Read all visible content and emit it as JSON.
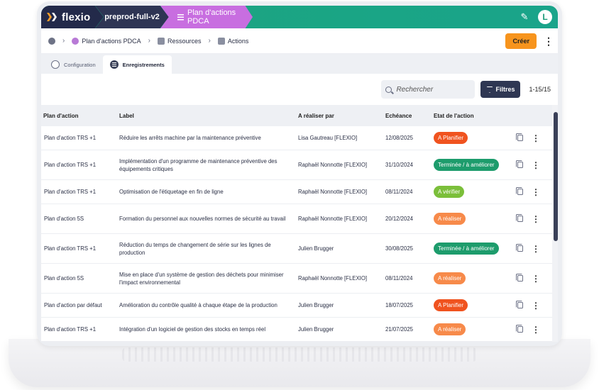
{
  "topbar": {
    "logo": "flexio",
    "environment": "preprod-full-v2",
    "app_name": "Plan d'actions PDCA",
    "avatar_letter": "L"
  },
  "breadcrumb": {
    "items": [
      "Plan d'actions PDCA",
      "Ressources",
      "Actions"
    ]
  },
  "toolbar": {
    "create_label": "Créer"
  },
  "tabs": [
    "Configuration",
    "Enregistrements"
  ],
  "search": {
    "placeholder": "Rechercher"
  },
  "filters": {
    "label": "Filtres",
    "pager": "1-15/15"
  },
  "table": {
    "headers": [
      "Plan d'action",
      "Label",
      "A réaliser par",
      "Echéance",
      "Etat de l'action"
    ],
    "rows": [
      {
        "plan": "Plan d'action TRS +1",
        "label": "Réduire les arrêts machine par la maintenance préventive",
        "owner": "Lisa Gautreau [FLEXIO]",
        "due": "12/08/2025",
        "status": "A Planifier",
        "status_color": "#f0531f"
      },
      {
        "plan": "Plan d'action TRS +1",
        "label": "Implémentation d'un programme de maintenance préventive des équipements critiques",
        "owner": "Raphaël Nonnotte [FLEXIO]",
        "due": "31/10/2024",
        "status": "Terminée / à améliorer",
        "status_color": "#1d9c6c"
      },
      {
        "plan": "Plan d'action TRS +1",
        "label": "Optimisation de l'étiquetage en fin de ligne",
        "owner": "Raphaël Nonnotte [FLEXIO]",
        "due": "08/11/2024",
        "status": "A vérifier",
        "status_color": "#7bbf3a"
      },
      {
        "plan": "Plan d'action 5S",
        "label": "Formation du personnel aux nouvelles normes de sécurité au travail",
        "owner": "Raphaël Nonnotte [FLEXIO]",
        "due": "20/12/2024",
        "status": "A réaliser",
        "status_color": "#f78a4a"
      },
      {
        "plan": "Plan d'action TRS +1",
        "label": "Réduction du temps de changement de série sur les lignes de production",
        "owner": "Julien Brugger",
        "due": "30/08/2025",
        "status": "Terminée / à améliorer",
        "status_color": "#1d9c6c"
      },
      {
        "plan": "Plan d'action 5S",
        "label": "Mise en place d'un système de gestion des déchets pour minimiser l'impact environnemental",
        "owner": "Raphaël Nonnotte [FLEXIO]",
        "due": "08/11/2024",
        "status": "A réaliser",
        "status_color": "#f78a4a"
      },
      {
        "plan": "Plan d'action par défaut",
        "label": "Amélioration du contrôle qualité à chaque étape de la production",
        "owner": "Julien Brugger",
        "due": "18/07/2025",
        "status": "A Planifier",
        "status_color": "#f0531f"
      },
      {
        "plan": "Plan d'action TRS +1",
        "label": "Intégration d'un logiciel de gestion des stocks en temps réel",
        "owner": "Julien Brugger",
        "due": "21/07/2025",
        "status": "A réaliser",
        "status_color": "#f78a4a"
      }
    ]
  },
  "colors": {
    "accent": "#1aa585",
    "app_tag": "#c86ee0",
    "create_button": "#f7941d",
    "dark": "#2f3753"
  }
}
